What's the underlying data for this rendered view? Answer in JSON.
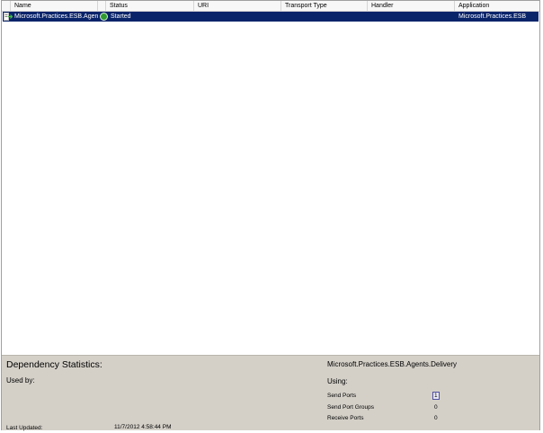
{
  "table": {
    "columns": [
      "Name",
      "Status",
      "URI",
      "Transport Type",
      "Handler",
      "Application"
    ],
    "rows": [
      {
        "name": "Microsoft.Practices.ESB.Agents_...",
        "status": "Started",
        "uri": "",
        "transport_type": "",
        "handler": "",
        "application": "Microsoft.Practices.ESB"
      }
    ]
  },
  "stats": {
    "title": "Dependency Statistics:",
    "used_by_label": "Used by:",
    "selected_name": "Microsoft.Practices.ESB.Agents.Delivery",
    "using_label": "Using:",
    "items": [
      {
        "label": "Send Ports",
        "value": "1"
      },
      {
        "label": "Send Port Groups",
        "value": "0"
      },
      {
        "label": "Receive Ports",
        "value": "0"
      }
    ],
    "last_updated_label": "Last Updated:",
    "last_updated_value": "11/7/2012 4:58:44 PM"
  },
  "colors": {
    "selection": "#0a246a",
    "panel": "#d4d0c8",
    "status_started": "#2f9a2f"
  },
  "icons": {
    "row_icon": "send-port-icon",
    "status_icon": "started-status-icon"
  }
}
